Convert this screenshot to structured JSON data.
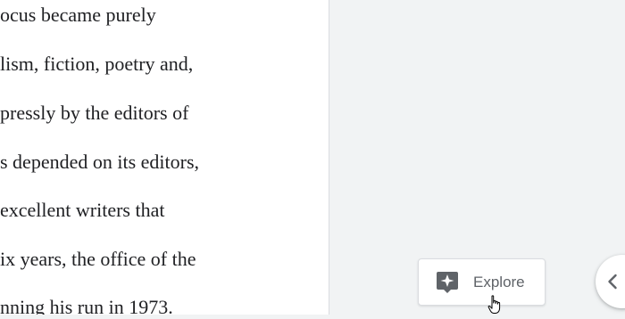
{
  "document": {
    "lines": [
      "ocus became purely",
      "lism, fiction, poetry and,",
      "pressly by the editors of",
      "s depended on its editors,",
      "excellent writers that",
      "ix years, the office of the",
      "nning his run in 1973."
    ]
  },
  "explore": {
    "label": "Explore",
    "icon": "explore-star-icon"
  },
  "side_panel_toggle": {
    "icon": "chevron-left-icon"
  },
  "cursor": {
    "icon": "hand-pointer-icon"
  },
  "colors": {
    "page_background": "#ffffff",
    "canvas_background": "#f1f3f4",
    "icon_gray": "#5f6368",
    "text": "#202124"
  }
}
